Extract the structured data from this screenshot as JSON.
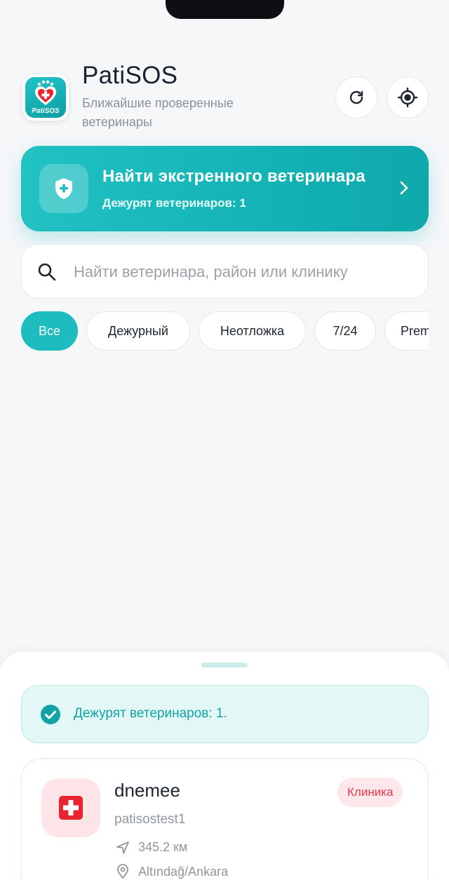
{
  "header": {
    "title": "PatiSOS",
    "subtitle": "Ближайшие проверенные ветеринары",
    "logo_text": "PatiSOS"
  },
  "emergency": {
    "title": "Найти экстренного ветеринара",
    "subtitle": "Дежурят ветеринаров: 1"
  },
  "search": {
    "placeholder": "Найти ветеринара, район или клинику",
    "value": ""
  },
  "filters": {
    "chips": [
      {
        "label": "Все",
        "active": true
      },
      {
        "label": "Дежурный",
        "active": false
      },
      {
        "label": "Неотложка",
        "active": false
      },
      {
        "label": "7/24",
        "active": false
      },
      {
        "label": "Premium",
        "active": false
      }
    ]
  },
  "sheet": {
    "notice": "Дежурят ветеринаров: 1.",
    "vets": [
      {
        "name": "dnemee",
        "username": "patisostest1",
        "badge": "Клиника",
        "distance": "345.2 км",
        "location": "Altındağ/Ankara"
      }
    ]
  },
  "colors": {
    "accent": "#1cbcbf",
    "background": "#f5f7f9",
    "badge_red": "#e53b4f",
    "clinic_icon_red": "#e8252f"
  }
}
